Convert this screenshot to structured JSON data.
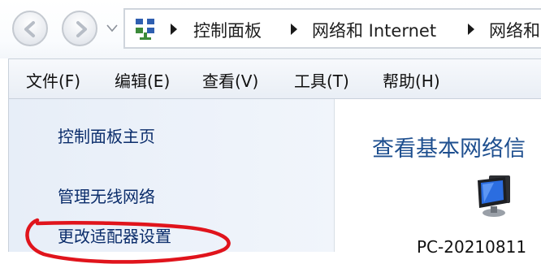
{
  "address_bar": {
    "crumbs": [
      "控制面板",
      "网络和 Internet",
      "网络和"
    ]
  },
  "menubar": {
    "items": [
      "文件(F)",
      "编辑(E)",
      "查看(V)",
      "工具(T)",
      "帮助(H)"
    ]
  },
  "sidebar": {
    "links": [
      "控制面板主页",
      "管理无线网络",
      "更改适配器设置"
    ],
    "highlight_color": "#e0141c"
  },
  "main": {
    "title": "查看基本网络信",
    "computer_name": "PC-20210811"
  },
  "icons": [
    "back-arrow-icon",
    "forward-arrow-icon",
    "history-dropdown-icon",
    "network-folder-icon",
    "computer-icon"
  ]
}
